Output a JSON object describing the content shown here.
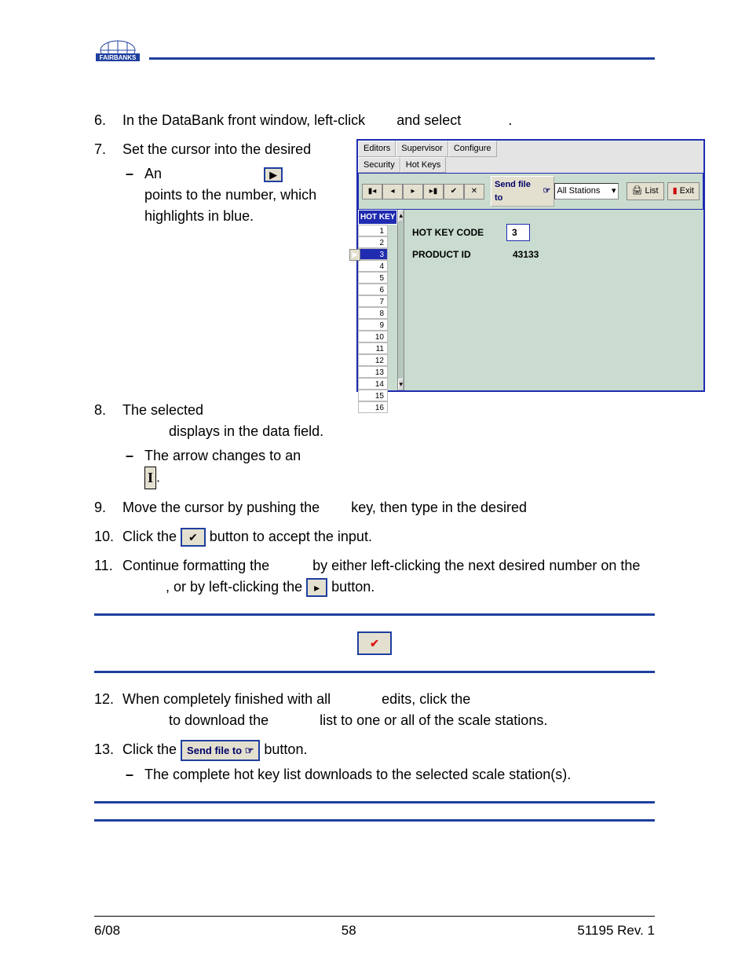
{
  "logo_text": "FAIRBANKS",
  "steps": {
    "s6_a": "In the DataBank front window, left-click",
    "s6_b": "and select",
    "s6_c": ".",
    "s7": "Set the cursor into the desired",
    "s7_sub_a": "An",
    "s7_sub_b": "points to the number, which highlights in blue.",
    "s8_a": "The selected",
    "s8_b": "displays in the data field.",
    "s8_sub": "The arrow changes to an",
    "s9_a": "Move the cursor by pushing the",
    "s9_b": "key, then type in the desired",
    "s10_a": "Click the",
    "s10_b": "button to accept the input.",
    "s11_a": "Continue formatting the",
    "s11_b": "by either left-clicking the next desired number on the",
    "s11_c": ", or by left-clicking the",
    "s11_d": "button.",
    "s12_a": "When completely finished with all",
    "s12_b": "edits, click the",
    "s12_c": "to download the",
    "s12_d": "list to one or all of the scale stations.",
    "s13_a": "Click the",
    "s13_b": "button.",
    "s13_sub": "The complete hot key list downloads to the selected scale station(s)."
  },
  "important_line": "",
  "note_line": "",
  "send_button_label": "Send file to",
  "screenshot": {
    "menu1": [
      "Editors",
      "Supervisor",
      "Configure"
    ],
    "menu2": [
      "Security",
      "Hot Keys"
    ],
    "toolbar": {
      "send_label": "Send file to",
      "combo": "All Stations",
      "list_btn": "List",
      "exit_btn": "Exit"
    },
    "list_header": "HOT KEY",
    "list_rows": [
      "1",
      "2",
      "3",
      "4",
      "5",
      "6",
      "7",
      "8",
      "9",
      "10",
      "11",
      "12",
      "13",
      "14",
      "15",
      "16"
    ],
    "selected_index": 2,
    "form": {
      "hot_key_code_label": "HOT KEY CODE",
      "hot_key_code_value": "3",
      "product_id_label": "PRODUCT ID",
      "product_id_value": "43133"
    }
  },
  "footer": {
    "left": "6/08",
    "center": "58",
    "right": "51195    Rev. 1"
  }
}
